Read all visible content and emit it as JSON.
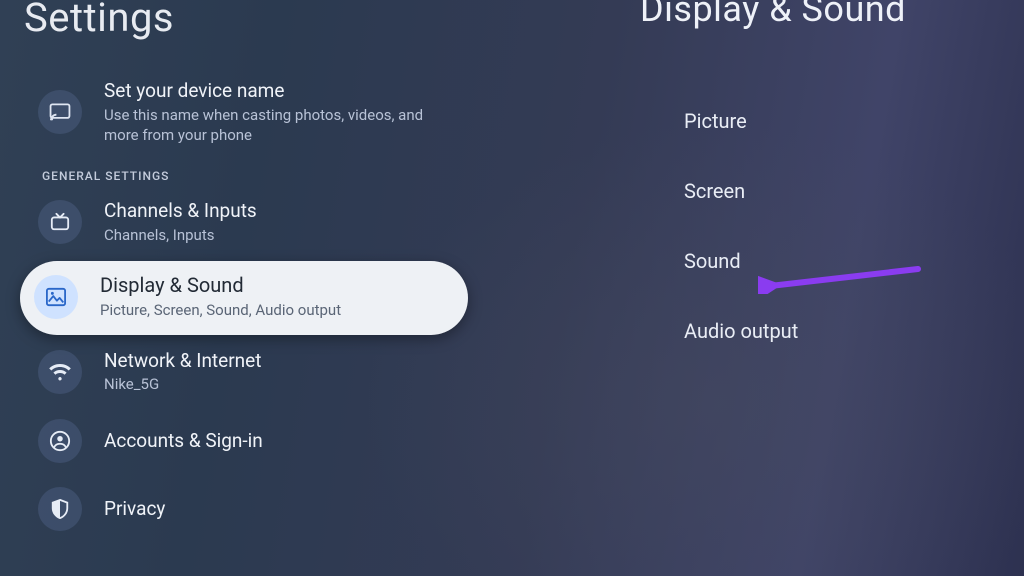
{
  "left": {
    "title": "Settings",
    "device_name": {
      "title": "Set your device name",
      "sub": "Use this name when casting photos, videos, and more from your phone"
    },
    "section_label": "GENERAL SETTINGS",
    "items": [
      {
        "title": "Channels & Inputs",
        "sub": "Channels, Inputs"
      },
      {
        "title": "Display & Sound",
        "sub": "Picture, Screen, Sound, Audio output"
      },
      {
        "title": "Network & Internet",
        "sub": "Nike_5G"
      },
      {
        "title": "Accounts & Sign-in",
        "sub": ""
      },
      {
        "title": "Privacy",
        "sub": ""
      }
    ]
  },
  "right": {
    "title": "Display & Sound",
    "items": [
      "Picture",
      "Screen",
      "Sound",
      "Audio output"
    ]
  },
  "colors": {
    "accent_arrow": "#8a3cf0",
    "selected_bg": "#eef1f5",
    "selected_icon_bg": "#cfe2ff"
  }
}
